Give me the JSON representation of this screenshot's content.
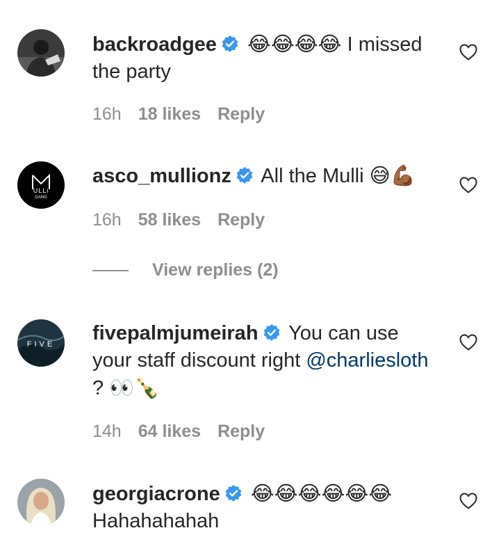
{
  "comments": [
    {
      "username": "backroadgee",
      "text_before": "",
      "emoji": "😂😂😂😂",
      "text": " I missed the party",
      "time": "16h",
      "likes": "18 likes",
      "reply": "Reply"
    },
    {
      "username": "asco_mullionz",
      "text": "All the Mulli ",
      "emoji": "😅💪🏾",
      "time": "16h",
      "likes": "58 likes",
      "reply": "Reply",
      "avatar_text": "MULLi GANG"
    },
    {
      "username": "fivepalmjumeirah",
      "text": "You can use your staff discount right ",
      "mention": "@charliesloth",
      "text_after": " ? ",
      "emoji": "👀🍾",
      "time": "14h",
      "likes": "64 likes",
      "reply": "Reply",
      "avatar_text": "FIVE"
    },
    {
      "username": "georgiacrone",
      "emoji": "😂😂😂😂😂😂",
      "text": "Hahahahahah",
      "time": "",
      "likes": "",
      "reply": ""
    }
  ],
  "view_replies": "View replies (2)",
  "colors": {
    "text": "#262626",
    "meta": "#8e8e8e",
    "mention": "#00376b",
    "verified": "#3897f0"
  }
}
